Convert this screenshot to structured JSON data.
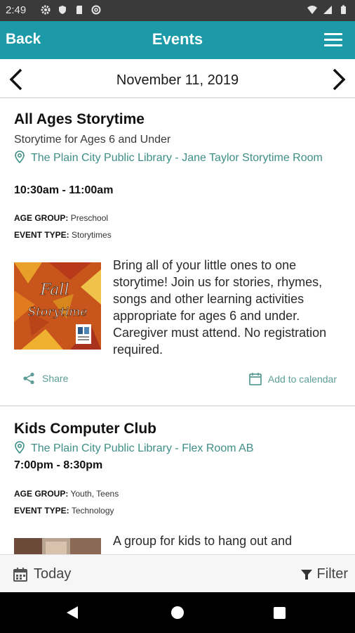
{
  "status_bar": {
    "time": "2:49",
    "left_icons": [
      "gear-icon",
      "shield-icon",
      "sd-card-icon",
      "circle-at-icon"
    ],
    "right_icons": [
      "wifi-icon",
      "signal-icon",
      "battery-icon"
    ]
  },
  "app_bar": {
    "back_label": "Back",
    "title": "Events",
    "menu_icon": "hamburger-menu-icon",
    "color": "#1c9aa7"
  },
  "date_nav": {
    "date": "November 11, 2019",
    "prev_icon": "chevron-left-icon",
    "next_icon": "chevron-right-icon"
  },
  "events": [
    {
      "title": "All Ages Storytime",
      "subtitle": "Storytime for Ages 6 and Under",
      "location": "The Plain City Public Library - Jane Taylor Storytime Room",
      "time": "10:30am - 11:00am",
      "age_group_label": "AGE GROUP:",
      "age_group": "Preschool",
      "event_type_label": "EVENT TYPE:",
      "event_type": "Storytimes",
      "image_text_1": "Fall",
      "image_text_2": "Storytime",
      "description": "Bring all of your little ones to one storytime! Join us for stories, rhymes, songs and other learning activities appropriate for ages 6 and under. Caregiver must attend. No registration required.",
      "share_label": "Share",
      "add_calendar_label": "Add to calendar"
    },
    {
      "title": "Kids Computer Club",
      "location": "The Plain City Public Library - Flex Room AB",
      "time": "7:00pm - 8:30pm",
      "age_group_label": "AGE GROUP:",
      "age_group": "Youth, Teens",
      "event_type_label": "EVENT TYPE:",
      "event_type": "Technology",
      "description": "A group for kids to hang out and"
    }
  ],
  "bottom_bar": {
    "today_label": "Today",
    "filter_label": "Filter"
  },
  "colors": {
    "accent": "#1c9aa7",
    "link": "#3e8f87",
    "action": "#5c9e97"
  }
}
